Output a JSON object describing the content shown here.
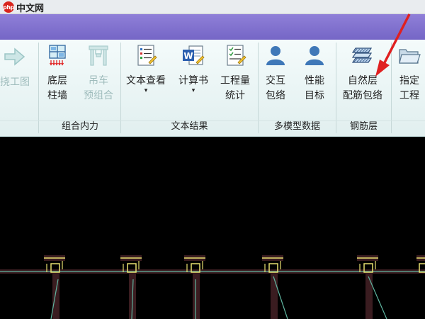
{
  "watermark": {
    "logo": "php",
    "text": "中文网"
  },
  "ribbon": {
    "partial_left": {
      "label1": "挠工图"
    },
    "buttons": [
      {
        "id": "base-wall",
        "line1": "底层",
        "line2": "柱墙",
        "enabled": true
      },
      {
        "id": "crane",
        "line1": "吊车",
        "line2": "预组合",
        "enabled": false
      },
      {
        "id": "text-view",
        "line1": "文本查看",
        "line2": "▾",
        "enabled": true
      },
      {
        "id": "calc-book",
        "line1": "计算书",
        "line2": "▾",
        "enabled": true
      },
      {
        "id": "quantity",
        "line1": "工程量",
        "line2": "统计",
        "enabled": true
      },
      {
        "id": "interact-env",
        "line1": "交互",
        "line2": "包络",
        "enabled": true
      },
      {
        "id": "perf-target",
        "line1": "性能",
        "line2": "目标",
        "enabled": true
      },
      {
        "id": "natural-rebar",
        "line1": "自然层",
        "line2": "配筋包络",
        "enabled": true
      },
      {
        "id": "specify-project",
        "line1": "指定",
        "line2": "工程",
        "enabled": true
      }
    ],
    "groups": [
      {
        "label": "组合内力"
      },
      {
        "label": "文本结果"
      },
      {
        "label": "多模型数据"
      },
      {
        "label": "钢筋层"
      }
    ]
  },
  "colors": {
    "accent_red": "#e02020",
    "canvas_bg": "#000000",
    "beam_line": "#5fb5a0",
    "node_yellow": "#e8e070"
  }
}
